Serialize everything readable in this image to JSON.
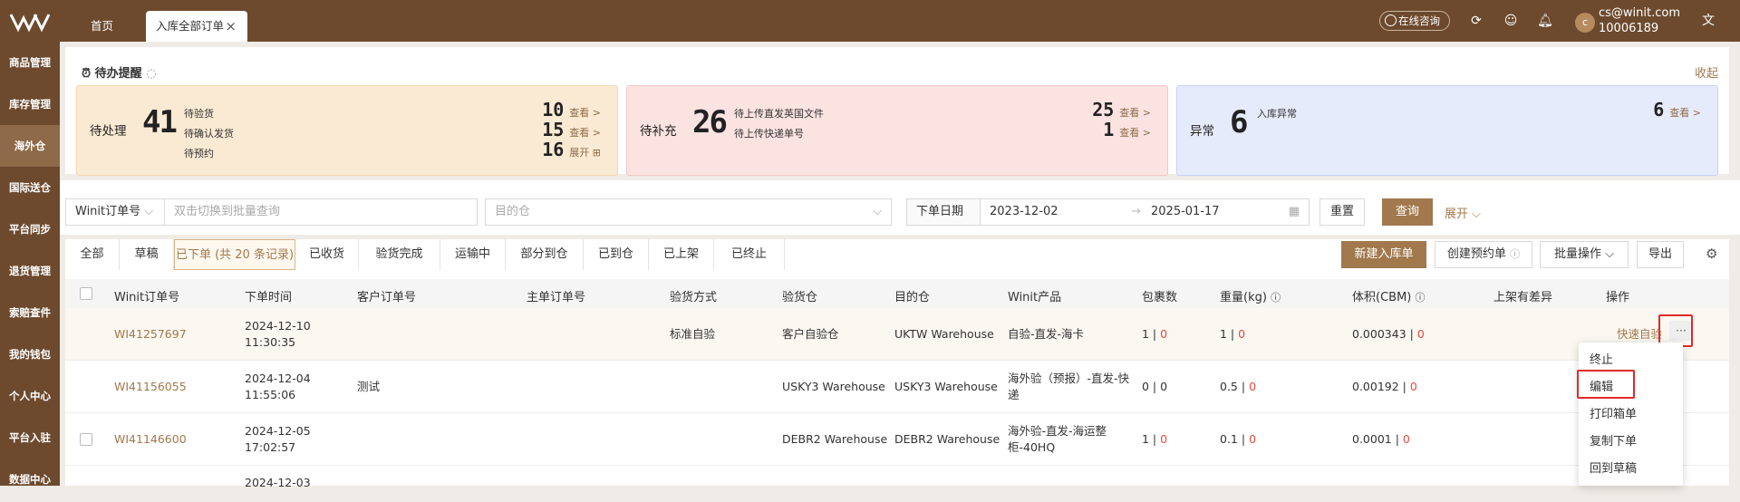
{
  "topbar": {
    "home": "首页",
    "active_tab": "入库全部订单",
    "close": "×",
    "consult": "在线咨询",
    "avatar_letter": "c",
    "email": "cs@winit.com",
    "user_id": "10006189"
  },
  "sidebar": {
    "items": [
      "商品管理",
      "库存管理",
      "海外仓",
      "国际送仓",
      "平台同步",
      "退货管理",
      "索赔查件",
      "我的钱包",
      "个人中心",
      "平台入驻",
      "数据中心"
    ],
    "active_index": 2
  },
  "todo": {
    "title": "待办提醒",
    "collapse": "收起",
    "cards": [
      {
        "label": "待处理",
        "count": "41",
        "items": [
          "待验货",
          "待确认发货",
          "待预约"
        ],
        "nums": [
          "10",
          "15",
          "16"
        ],
        "links": [
          "查看 >",
          "查看 >",
          "展开 ⊞"
        ]
      },
      {
        "label": "待补充",
        "count": "26",
        "items": [
          "待上传直发英国文件",
          "待上传快递单号"
        ],
        "nums": [
          "25",
          "1"
        ],
        "links": [
          "查看 >",
          "查看 >"
        ]
      },
      {
        "label": "异常",
        "count": "6",
        "items": [
          "入库异常"
        ],
        "nums": [
          "6"
        ],
        "links": [
          "查看 >"
        ]
      }
    ]
  },
  "filter": {
    "order_type": "Winit订单号",
    "search_placeholder": "双击切换到批量查询",
    "dest_placeholder": "目的仓",
    "date_label": "下单日期",
    "date_start": "2023-12-02",
    "date_end": "2025-01-17",
    "reset": "重置",
    "query": "查询",
    "expand": "展开"
  },
  "status_tabs": [
    "全部",
    "草稿",
    "已下单 (共 20 条记录)",
    "已收货",
    "验货完成",
    "运输中",
    "部分到仓",
    "已到仓",
    "已上架",
    "已终止"
  ],
  "actions": {
    "new_order": "新建入库单",
    "create_booking": "创建预约单",
    "batch": "批量操作",
    "export": "导出"
  },
  "columns": [
    "Winit订单号",
    "下单时间",
    "客户订单号",
    "主单订单号",
    "验货方式",
    "验货仓",
    "目的仓",
    "Winit产品",
    "包裹数",
    "重量(kg)",
    "体积(CBM)",
    "上架有差异",
    "操作"
  ],
  "rows": [
    {
      "order": "WI41257697",
      "date": "2024-12-10",
      "time": "11:30:35",
      "customer": "",
      "master": "",
      "inspect": "标准自验",
      "inspect_wh": "客户自验仓",
      "dest": "UKTW Warehouse",
      "product": "自验-直发-海卡",
      "pkg_a": "1",
      "pkg_b": "0",
      "wt_a": "1",
      "wt_b": "0",
      "vol_a": "0.000343",
      "vol_b": "0",
      "op": "快速自验",
      "more": "···"
    },
    {
      "order": "WI41156055",
      "date": "2024-12-04",
      "time": "11:55:06",
      "customer": "测试",
      "master": "",
      "inspect": "",
      "inspect_wh": "USKY3 Warehouse",
      "dest": "USKY3 Warehouse",
      "product": "海外验（预报）-直发-快递",
      "pkg_a": "0",
      "pkg_b": "0",
      "wt_a": "0.5",
      "wt_b": "0",
      "vol_a": "0.00192",
      "vol_b": "0",
      "op": "",
      "more": ""
    },
    {
      "order": "WI41146600",
      "date": "2024-12-05",
      "time": "17:02:57",
      "customer": "",
      "master": "",
      "inspect": "",
      "inspect_wh": "DEBR2 Warehouse",
      "dest": "DEBR2 Warehouse",
      "product": "海外验-直发-海运整柜-40HQ",
      "pkg_a": "1",
      "pkg_b": "0",
      "wt_a": "0.1",
      "wt_b": "0",
      "vol_a": "0.0001",
      "vol_b": "0",
      "op": "",
      "more": ""
    },
    {
      "order": "",
      "date": "2024-12-03",
      "time": "",
      "customer": "",
      "master": "",
      "inspect": "",
      "inspect_wh": "",
      "dest": "",
      "product": "",
      "pkg_a": "",
      "pkg_b": "",
      "wt_a": "",
      "wt_b": "",
      "vol_a": "",
      "vol_b": "",
      "op": "",
      "more": ""
    }
  ],
  "dropdown": [
    "终止",
    "编辑",
    "打印箱单",
    "复制下单",
    "回到草稿"
  ],
  "colors": {
    "brand": "#6d4a2e",
    "accent": "#a2784d",
    "alert": "#e02a2a"
  }
}
